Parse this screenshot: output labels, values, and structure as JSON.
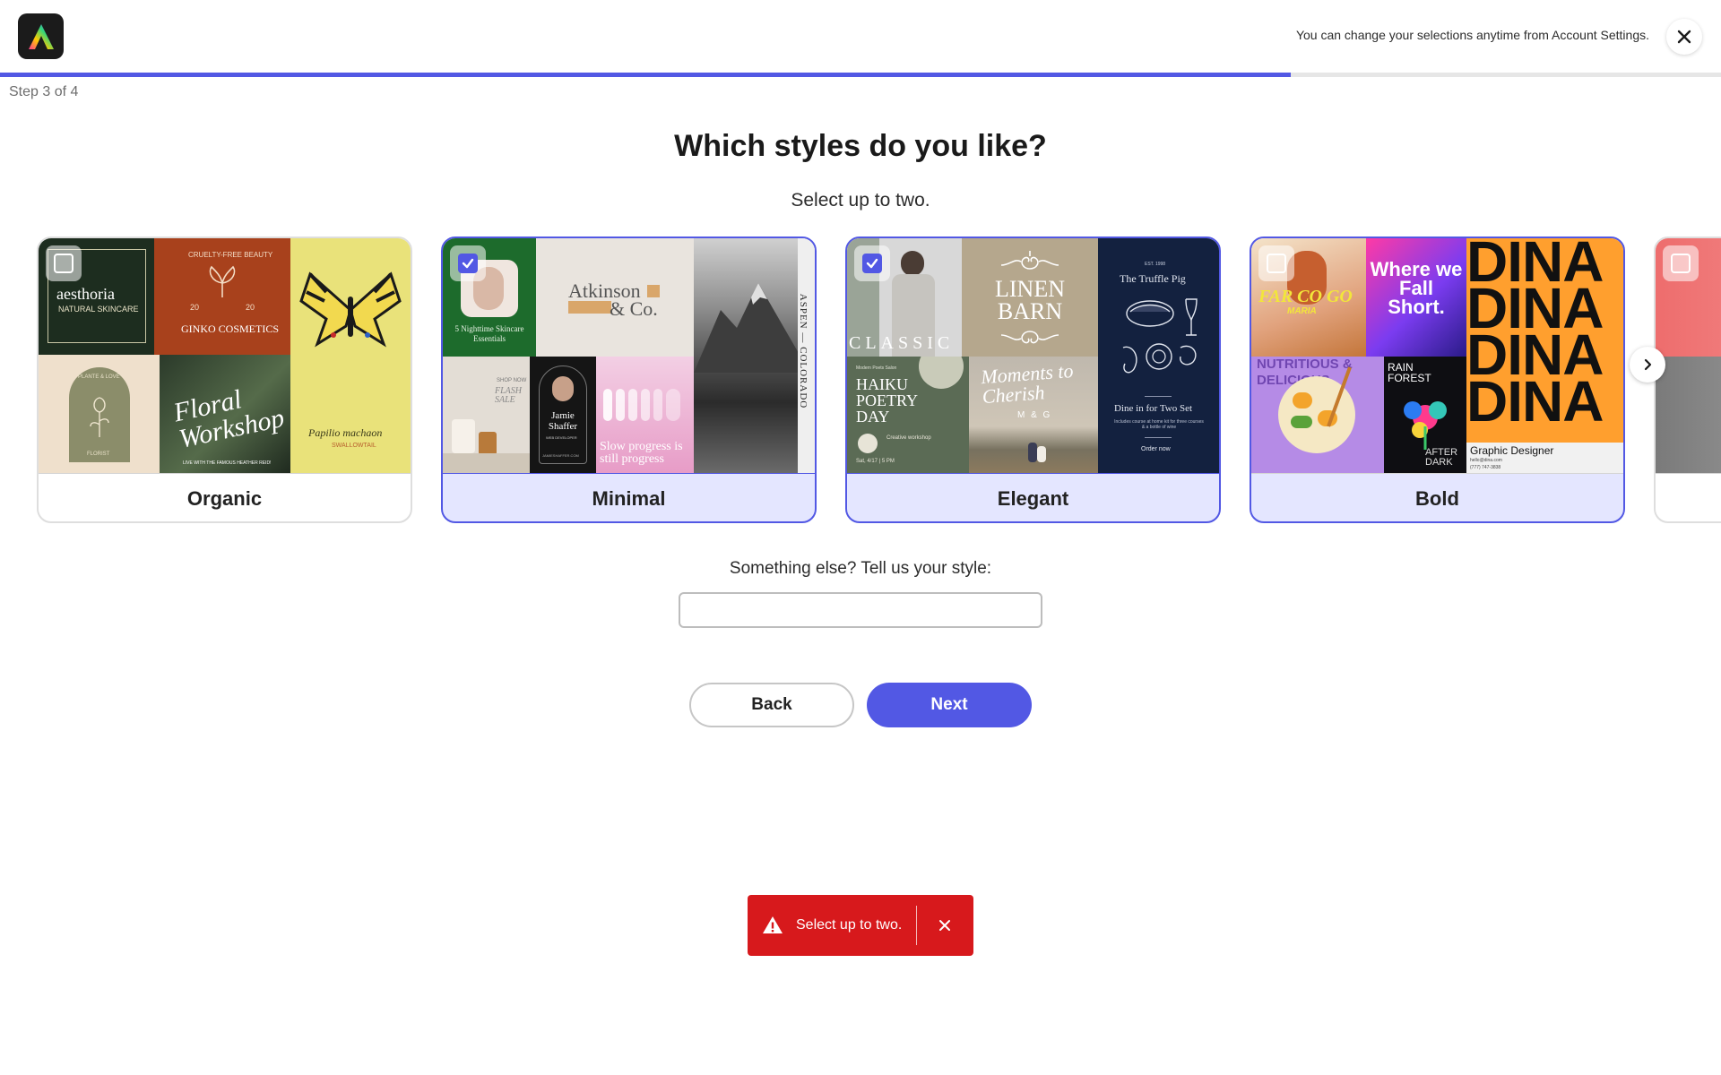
{
  "header": {
    "logo_icon": "adobe-express-logo",
    "note": "You can change your selections anytime from Account Settings.",
    "close_icon": "close-icon"
  },
  "progress": {
    "step_label": "Step 3 of 4",
    "fraction": 0.75,
    "color": "#5258e4"
  },
  "page": {
    "title": "Which styles do you like?",
    "subtitle": "Select up to two."
  },
  "styles": [
    {
      "label": "Organic",
      "selected": false,
      "tiles": {
        "aesthoria": "aesthoria",
        "aesthoria_sub": "NATURAL SKINCARE",
        "ginko_top": "CRUELTY-FREE BEAUTY",
        "ginko_y1": "20",
        "ginko_y2": "20",
        "ginko": "GINKO COSMETICS",
        "arch_top": "PLANTE & LOVE",
        "arch_bottom": "FLORIST",
        "floral": "Floral Workshop",
        "floral_sub": "LIVE WITH THE FAMOUS HEATHER REID!",
        "papilio": "Papilio machaon",
        "papilio_sub": "SWALLOWTAIL"
      }
    },
    {
      "label": "Minimal",
      "selected": true,
      "tiles": {
        "nighttime": "5 Nighttime Skincare Essentials",
        "atkinson_1": "Atkinson",
        "atkinson_2": "& Co.",
        "aspen": "ASPEN — COLORADO",
        "flash_top": "SHOP NOW",
        "flash": "FLASH SALE",
        "jamie": "Jamie Shaffer",
        "jamie_role": "WEB DEVELOPER",
        "jamie_contact": "JAMIESHAFFER.COM",
        "slow": "Slow progress is still progress"
      }
    },
    {
      "label": "Elegant",
      "selected": true,
      "tiles": {
        "classic": "CLASSIC",
        "linen": "LINEN BARN",
        "truffle_est": "EST. 1998",
        "truffle": "The Truffle Pig",
        "truffle_dine": "Dine in for Two Set",
        "truffle_desc": "Includes course at home kit for three courses & a bottle of wine",
        "truffle_order": "Order now",
        "haiku_top": "Modern Poets Salon",
        "haiku": "HAIKU POETRY DAY",
        "haiku_ws": "Creative workshop",
        "haiku_date": "Sat, 4/17 | 5 PM",
        "moments": "Moments to Cherish",
        "moments_sub": "M & G"
      }
    },
    {
      "label": "Bold",
      "selected": false,
      "tiles": {
        "farcogo": "FAR CO GO",
        "farcogo_sub": "MARIA",
        "where": "Where we Fall Short.",
        "dina": "DINA",
        "dina_role": "Graphic Designer",
        "dina_email": "hello@dina.com",
        "dina_phone": "(777) 747-3838",
        "nutri": "NUTRITIOUS & DELICIOUS",
        "rain": "RAIN FOREST",
        "after": "AFTER DARK"
      }
    },
    {
      "label": "",
      "selected": false,
      "tiles": {}
    }
  ],
  "other": {
    "label": "Something else? Tell us your style:",
    "value": "",
    "placeholder": ""
  },
  "buttons": {
    "back": "Back",
    "next": "Next"
  },
  "toast": {
    "icon": "alert-icon",
    "message": "Select up to two.",
    "close_icon": "close-icon",
    "color": "#d7191c"
  },
  "colors": {
    "accent": "#5258e4",
    "selected_card_bg": "#e4e6ff",
    "error": "#d7191c"
  }
}
